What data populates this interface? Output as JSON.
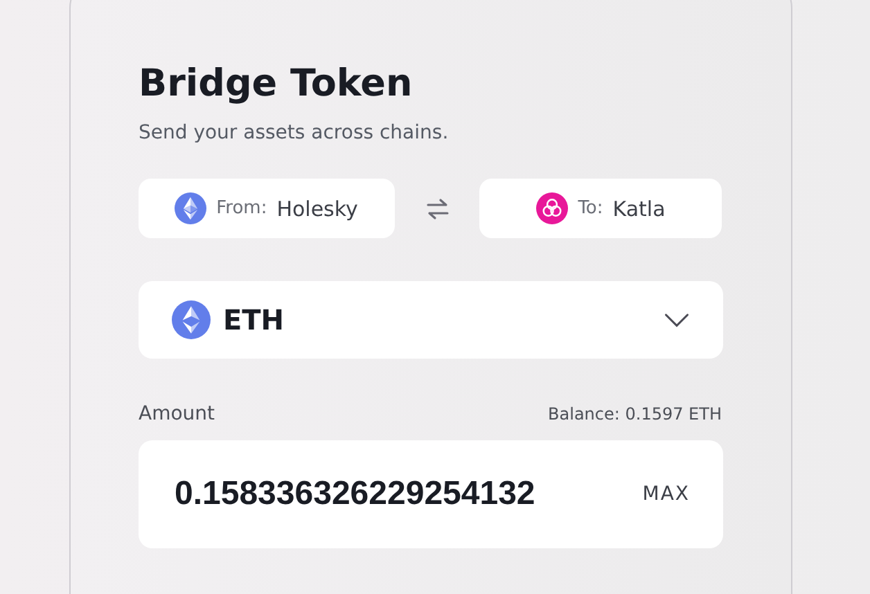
{
  "card": {
    "title": "Bridge Token",
    "subtitle": "Send your assets across chains."
  },
  "chains": {
    "from": {
      "label": "From:",
      "name": "Holesky",
      "kind": "ethereum"
    },
    "to": {
      "label": "To:",
      "name": "Katla",
      "kind": "taiko"
    }
  },
  "token": {
    "symbol": "ETH",
    "kind": "ethereum"
  },
  "amount": {
    "label": "Amount",
    "balance": "Balance: 0.1597 ETH",
    "value": "0.158336326229254132",
    "max_button": "MAX"
  }
}
